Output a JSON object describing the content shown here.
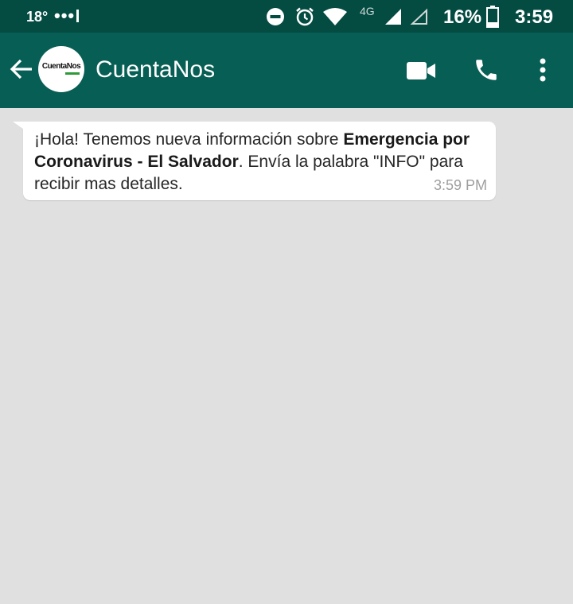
{
  "status_bar": {
    "temperature": "18°",
    "notification_dots": "•••",
    "network": "4G",
    "battery": "16%",
    "time": "3:59",
    "icons": [
      "do-not-disturb-icon",
      "alarm-icon",
      "wifi-icon",
      "signal-icon",
      "signal-empty-icon",
      "battery-icon"
    ]
  },
  "header": {
    "back_icon": "arrow-left-icon",
    "avatar_text": "CuentaNos",
    "contact_name": "CuentaNos",
    "actions": [
      "video-call-icon",
      "phone-icon",
      "more-vert-icon"
    ]
  },
  "chat": {
    "messages": [
      {
        "direction": "incoming",
        "text_prefix": "¡Hola! Tenemos nueva información sobre ",
        "text_bold": "Emergencia por Coronavirus - El Salvador",
        "text_suffix": ". Envía la palabra \"INFO\" para recibir mas detalles.",
        "time": "3:59 PM"
      }
    ]
  },
  "colors": {
    "status_bar": "#044b42",
    "app_bar": "#075e54",
    "chat_background": "#e0e0e0",
    "bubble": "#ffffff"
  }
}
